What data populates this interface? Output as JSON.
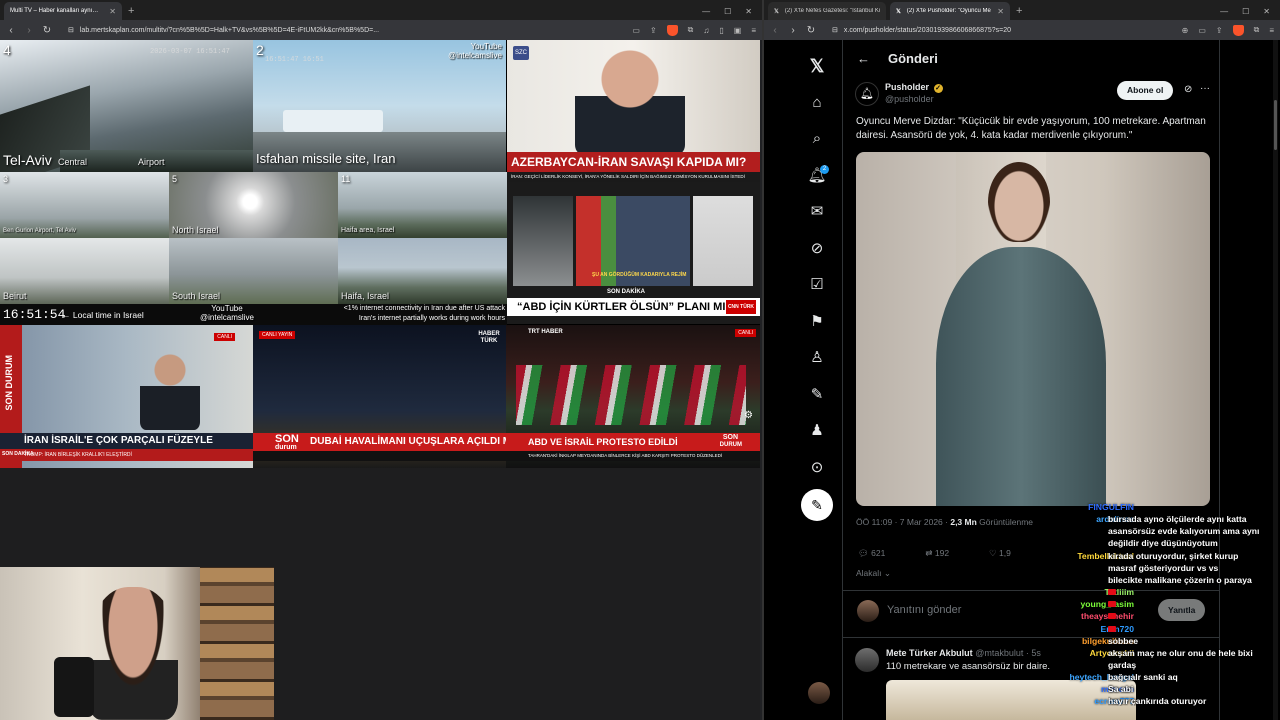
{
  "left_browser": {
    "tabs": [
      {
        "label": "Multi TV – Haber kanalları aynı…"
      }
    ],
    "url": "lab.mertskaplan.com/multitv/?cn%5B%5D=Halk+TV&vs%5B%5D=4E-iFtUM2kk&cn%5B%5D=..."
  },
  "multiview": {
    "telaviv": {
      "num": "4",
      "label": "Tel-Aviv",
      "central": "Central",
      "airport": "Airport",
      "ts": "2026-03-07 16:51:47"
    },
    "isfahan": {
      "num": "2",
      "label": "Isfahan missile site, Iran",
      "ts": "16:51:47 16:51",
      "yt1": "YouTube",
      "yt2": "@intelcamslive"
    },
    "cams": [
      {
        "num": "3",
        "label": "Ben Gurion Airport, Tel Aviv"
      },
      {
        "num": "5",
        "label": "North Israel"
      },
      {
        "num": "11",
        "label": "Haifa area, Israel"
      },
      {
        "num": "",
        "label": "Beirut"
      },
      {
        "num": "",
        "label": "South Israel"
      },
      {
        "num": "",
        "label": "Haifa, Israel"
      }
    ],
    "clock": "16:51:54",
    "local_time": "← Local time in Israel",
    "yt_bottom1": "YouTube",
    "yt_bottom2": "@intelcamslive",
    "ticker": "<1% internet connectivity in Iran due after US attack",
    "ticker2": "Iran's internet partially works during work hours",
    "aliyev": {
      "banner": "AZERBAYCAN-İRAN SAVAŞI KAPIDA MI?",
      "logo": "SZC",
      "sub": "İRAN: GEÇİCİ LİDERLİK KONSEYİ, İRAN'A YÖNELİK SALDIRI İÇİN BAĞIMSIZ KOMİSYON KURULMASINI İSTEDİ"
    },
    "panel": {
      "subtitle": "ŞU AN GÖRDÜĞÜM KADARIYLA REJİM",
      "flash": "SON DAKİKA",
      "banner": "“ABD İÇİN KÜRTLER ÖLSÜN” PLANI MI?",
      "logo": "CNN TÜRK"
    },
    "ntv": {
      "side": "SON DURUM",
      "banner": "İRAN İSRAİL'E ÇOK PARÇALI FÜZEYLE SALDIRDI",
      "sub": "TRUMP: İRAN BİRLEŞİK KRALLIK'I ELEŞTİRDİ",
      "live": "CANLI",
      "flash": "SON DAKİKA"
    },
    "dubai": {
      "son": "SON",
      "durum": "durum",
      "banner": "DUBAİ HAVALİMANI UÇUŞLARA AÇILDI MI?",
      "logo": "HABER TÜRK",
      "cap": "CANLI YAYIN"
    },
    "iran": {
      "banner": "ABD VE İSRAİL PROTESTO EDİLDİ",
      "son": "SON",
      "durum": "DURUM",
      "logo": "TRT HABER",
      "live": "CANLI",
      "sub": "TAHRAN'DAKİ İNKILAP MEYDANINDA BİNLERCE KİŞİ ABD KARŞITI PROTESTO DÜZENLEDİ"
    }
  },
  "right_browser": {
    "tabs": [
      {
        "label": "(2) X'te Nefes Gazetesi: \"İstanbul Kü…"
      },
      {
        "label": "(2) X'te Pusholder: \"Oyuncu Me…"
      }
    ],
    "url": "x.com/pusholder/status/2030193986606866875?s=20"
  },
  "x": {
    "header": {
      "title": "Gönderi"
    },
    "nav": {
      "notif_badge": "2"
    },
    "post": {
      "author_name": "Pusholder",
      "author_handle": "@pusholder",
      "subscribe": "Abone ol",
      "text": "Oyuncu Merve Dizdar: \"Küçücük bir evde yaşıyorum, 100 metrekare. Apartman dairesi. Asansörü de yok, 4. kata kadar merdivenle çıkıyorum.\"",
      "time": "ÖÖ 11:09 · 7 Mar 2026 · ",
      "views_count": "2,3 Mn",
      "views_label": "Görüntülenme",
      "replies": "621",
      "reposts": "192",
      "likes": "1,9"
    },
    "relevance": "Alakalı",
    "reply": {
      "placeholder": "Yanıtını gönder",
      "button": "Yanıtla"
    },
    "reply_tweet": {
      "name": "Mete Türker Akbulut",
      "handle": "@mtakbulut · 5s",
      "text": "110 metrekare ve asansörsüz bir daire."
    }
  },
  "chat": [
    {
      "user": "FINGULFIN",
      "color": "#2e6cff",
      "msg": ""
    },
    {
      "user": "ardalinee",
      "color": "#3ea6ff",
      "msg": "bursada ayno ölçülerde aynı katta"
    },
    {
      "user": "",
      "color": "#fff",
      "msg": "asansörsüz evde kalıyorum ama aynı"
    },
    {
      "user": "",
      "color": "#fff",
      "msg": "değildir diye düşünüyotum"
    },
    {
      "user": "Tembellektuel",
      "color": "#ffd93b",
      "msg": "kirada oturuyordur, şirket kurup"
    },
    {
      "user": "",
      "color": "#fff",
      "msg": "masraf gösteriyordur vs vs"
    },
    {
      "user": "",
      "color": "#fff",
      "msg": "bilecikte malikane çözerin o paraya"
    },
    {
      "user": "Tatliiim",
      "color": "#9df56b",
      "msg": ""
    },
    {
      "user": "young_rasim",
      "color": "#7cfc3a",
      "msg": ""
    },
    {
      "user": "theaysenehir",
      "color": "#ff4d6d",
      "msg": ""
    },
    {
      "user": "Eren720",
      "color": "#2e9bff",
      "msg": ""
    },
    {
      "user": "bilgekulkaan",
      "color": "#ff9f2e",
      "msg": "sobbee"
    },
    {
      "user": "Artyomskii",
      "color": "#ffd93b",
      "msg": "akşam maç ne olur onu de hele bixi"
    },
    {
      "user": "",
      "color": "#fff",
      "msg": "gardaş"
    },
    {
      "user": "heytech_kangal",
      "color": "#3ea6ff",
      "msg": "bağcıalr sanki aq"
    },
    {
      "user": "mimoan",
      "color": "#2e6cff",
      "msg": "Sa abi"
    },
    {
      "user": "ecrem777",
      "color": "#2e9bff",
      "msg": "hayır çankırıda oturuyor"
    }
  ]
}
